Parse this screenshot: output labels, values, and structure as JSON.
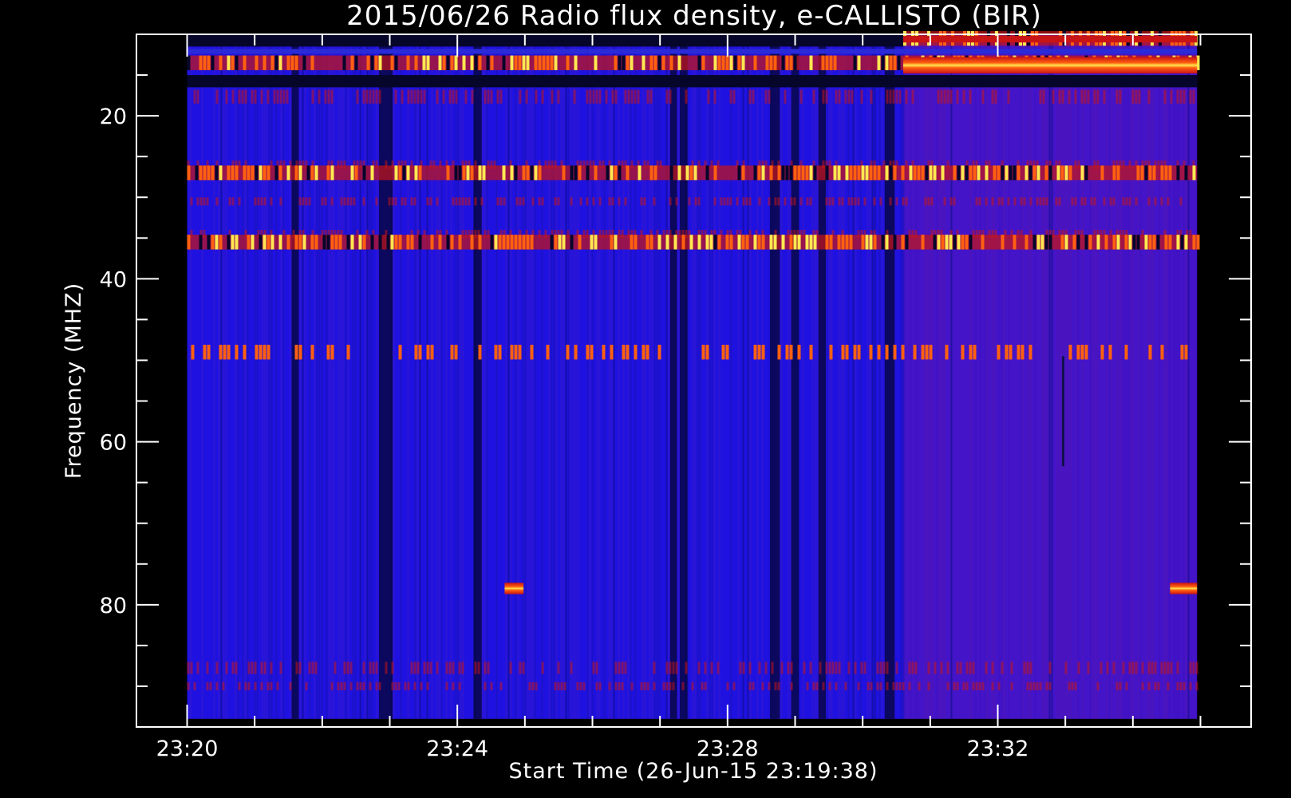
{
  "chart_data": {
    "type": "heatmap",
    "title": "2015/06/26  Radio flux density, e-CALLISTO (BIR)",
    "xlabel": "Start Time (26-Jun-15 23:19:38)",
    "ylabel": "Frequency (MHZ)",
    "x_ticks": [
      {
        "label": "23:20",
        "minutes": 0
      },
      {
        "label": "23:24",
        "minutes": 4
      },
      {
        "label": "23:28",
        "minutes": 8
      },
      {
        "label": "23:32",
        "minutes": 12
      }
    ],
    "x_range_minutes": [
      -0.75,
      15.75
    ],
    "x_data_minutes": [
      0.0,
      14.95
    ],
    "y_ticks": [
      20,
      40,
      60,
      80
    ],
    "ylim": [
      95,
      10
    ],
    "y_data_range": [
      10,
      94
    ],
    "grid": false,
    "colors": {
      "background": "#000000",
      "base_blue": "#1f12e0",
      "purple": "#5a14b4",
      "dark_band": "#050535",
      "red": "#c81414",
      "orange": "#ff6010",
      "yellow": "#ffe850"
    },
    "bright_bands_mhz": [
      {
        "freq": 10.5,
        "t0": 10.6,
        "t1": 14.95,
        "level": "red-yellow"
      },
      {
        "freq": 13.5,
        "t0": 0.0,
        "t1": 14.95,
        "level": "orange-yellow"
      },
      {
        "freq": 27.0,
        "t0": 0.0,
        "t1": 14.95,
        "level": "orange-yellow"
      },
      {
        "freq": 35.5,
        "t0": 0.0,
        "t1": 14.95,
        "level": "orange-yellow"
      },
      {
        "freq": 49.0,
        "t0": 0.0,
        "t1": 14.95,
        "level": "faint-red"
      }
    ],
    "bright_spots": [
      {
        "freq": 78,
        "t0": 4.7,
        "t1": 4.98,
        "level": "yellow"
      },
      {
        "freq": 78,
        "t0": 14.55,
        "t1": 14.95,
        "level": "yellow"
      }
    ],
    "dark_vertical_times_min": [
      1.6,
      2.9,
      3.0,
      4.3,
      7.2,
      7.35,
      8.7,
      9.0,
      9.4,
      10.4
    ]
  }
}
